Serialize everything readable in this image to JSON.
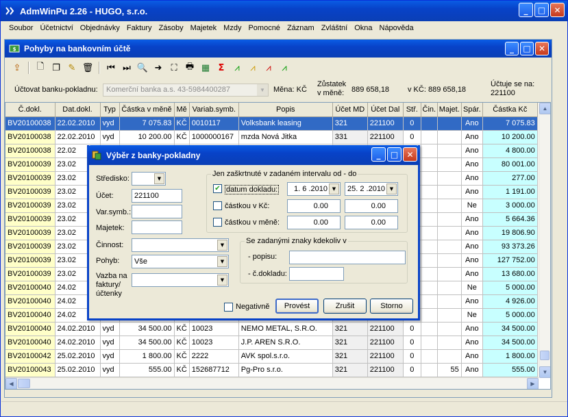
{
  "app": {
    "title": "AdmWinPu 2.26 - HUGO, s.r.o."
  },
  "menu": [
    "Soubor",
    "Účetnictví",
    "Objednávky",
    "Faktury",
    "Zásoby",
    "Majetek",
    "Mzdy",
    "Pomocné",
    "Záznam",
    "Zvláštní",
    "Okna",
    "Nápověda"
  ],
  "window": {
    "title": "Pohyby na bankovním účtě"
  },
  "account": {
    "label": "Účtovat banku-pokladnu:",
    "value": "Komerční banka a.s. 43-5984400287",
    "currency_label": "Měna: KČ",
    "balance_label": "Zůstatek",
    "balance_label2": "v měně:",
    "balance": "889 658,18",
    "balance_kc_label": "v KČ:",
    "balance_kc": "889 658,18",
    "account_label": "Účtuje se na:",
    "account": "221100"
  },
  "grid": {
    "columns": [
      "Č.dokl.",
      "Dat.dokl.",
      "Typ",
      "Částka v měně",
      "Mě",
      "Variab.symb.",
      "Popis",
      "Účet MD",
      "Účet Dal",
      "Stř.",
      "Čin.",
      "Majet.",
      "Spár.",
      "Částka Kč"
    ],
    "rows": [
      {
        "doc": "BV20100038",
        "date": "22.02.2010",
        "typ": "vyd",
        "amount": "7 075.83",
        "cur": "KČ",
        "vs": "0010117",
        "desc": "Volksbank leasing",
        "md": "321",
        "dal": "221100",
        "str": "0",
        "cin": "",
        "maj": "",
        "spar": "Ano",
        "kc": "7 075.83",
        "selected": true
      },
      {
        "doc": "BV20100038",
        "date": "22.02.2010",
        "typ": "vyd",
        "amount": "10 200.00",
        "cur": "KČ",
        "vs": "1000000167",
        "desc": "mzda Nová Jitka",
        "md": "331",
        "dal": "221100",
        "str": "0",
        "cin": "",
        "maj": "",
        "spar": "Ano",
        "kc": "10 200.00"
      },
      {
        "doc": "BV20100038",
        "date": "22.02",
        "typ": "",
        "amount": "",
        "cur": "",
        "vs": "",
        "desc": "",
        "md": "",
        "dal": "",
        "str": "",
        "cin": "",
        "maj": "",
        "spar": "Ano",
        "kc": "4 800.00"
      },
      {
        "doc": "BV20100039",
        "date": "23.02",
        "typ": "",
        "amount": "",
        "cur": "",
        "vs": "",
        "desc": "",
        "md": "",
        "dal": "",
        "str": "",
        "cin": "",
        "maj": "",
        "spar": "Ano",
        "kc": "80 001.00"
      },
      {
        "doc": "BV20100039",
        "date": "23.02",
        "typ": "",
        "amount": "",
        "cur": "",
        "vs": "",
        "desc": "",
        "md": "",
        "dal": "",
        "str": "",
        "cin": "",
        "maj": "",
        "spar": "Ano",
        "kc": "277.00"
      },
      {
        "doc": "BV20100039",
        "date": "23.02",
        "typ": "",
        "amount": "",
        "cur": "",
        "vs": "",
        "desc": "",
        "md": "",
        "dal": "",
        "str": "",
        "cin": "",
        "maj": "",
        "spar": "Ano",
        "kc": "1 191.00"
      },
      {
        "doc": "BV20100039",
        "date": "23.02",
        "typ": "",
        "amount": "",
        "cur": "",
        "vs": "",
        "desc": "",
        "md": "",
        "dal": "",
        "str": "",
        "cin": "",
        "maj": "",
        "spar": "Ne",
        "kc": "3 000.00"
      },
      {
        "doc": "BV20100039",
        "date": "23.02",
        "typ": "",
        "amount": "",
        "cur": "",
        "vs": "",
        "desc": "",
        "md": "",
        "dal": "",
        "str": "",
        "cin": "",
        "maj": "",
        "spar": "Ano",
        "kc": "5 664.36"
      },
      {
        "doc": "BV20100039",
        "date": "23.02",
        "typ": "",
        "amount": "",
        "cur": "",
        "vs": "",
        "desc": "",
        "md": "",
        "dal": "",
        "str": "",
        "cin": "",
        "maj": "",
        "spar": "Ano",
        "kc": "19 806.90"
      },
      {
        "doc": "BV20100039",
        "date": "23.02",
        "typ": "",
        "amount": "",
        "cur": "",
        "vs": "",
        "desc": "",
        "md": "",
        "dal": "",
        "str": "",
        "cin": "",
        "maj": "",
        "spar": "Ano",
        "kc": "93 373.26"
      },
      {
        "doc": "BV20100039",
        "date": "23.02",
        "typ": "",
        "amount": "",
        "cur": "",
        "vs": "",
        "desc": "",
        "md": "",
        "dal": "",
        "str": "",
        "cin": "",
        "maj": "",
        "spar": "Ano",
        "kc": "127 752.00"
      },
      {
        "doc": "BV20100039",
        "date": "23.02",
        "typ": "",
        "amount": "",
        "cur": "",
        "vs": "",
        "desc": "",
        "md": "",
        "dal": "",
        "str": "",
        "cin": "",
        "maj": "",
        "spar": "Ano",
        "kc": "13 680.00"
      },
      {
        "doc": "BV20100040",
        "date": "24.02",
        "typ": "",
        "amount": "",
        "cur": "",
        "vs": "",
        "desc": "",
        "md": "",
        "dal": "",
        "str": "",
        "cin": "",
        "maj": "",
        "spar": "Ne",
        "kc": "5 000.00"
      },
      {
        "doc": "BV20100040",
        "date": "24.02",
        "typ": "",
        "amount": "",
        "cur": "",
        "vs": "",
        "desc": "",
        "md": "",
        "dal": "",
        "str": "",
        "cin": "",
        "maj": "",
        "spar": "Ano",
        "kc": "4 926.00"
      },
      {
        "doc": "BV20100040",
        "date": "24.02",
        "typ": "",
        "amount": "",
        "cur": "",
        "vs": "",
        "desc": "",
        "md": "",
        "dal": "",
        "str": "",
        "cin": "",
        "maj": "",
        "spar": "Ne",
        "kc": "5 000.00"
      },
      {
        "doc": "BV20100040",
        "date": "24.02.2010",
        "typ": "vyd",
        "amount": "34 500.00",
        "cur": "KČ",
        "vs": "10023",
        "desc": "NEMO METAL, S.R.O.",
        "md": "321",
        "dal": "221100",
        "str": "0",
        "cin": "",
        "maj": "",
        "spar": "Ano",
        "kc": "34 500.00"
      },
      {
        "doc": "BV20100040",
        "date": "24.02.2010",
        "typ": "vyd",
        "amount": "34 500.00",
        "cur": "KČ",
        "vs": "10023",
        "desc": "J.P. AREN S.R.O.",
        "md": "321",
        "dal": "221100",
        "str": "0",
        "cin": "",
        "maj": "",
        "spar": "Ano",
        "kc": "34 500.00"
      },
      {
        "doc": "BV20100042",
        "date": "25.02.2010",
        "typ": "vyd",
        "amount": "1 800.00",
        "cur": "KČ",
        "vs": "2222",
        "desc": "AVK spol.s.r.o.",
        "md": "321",
        "dal": "221100",
        "str": "0",
        "cin": "",
        "maj": "",
        "spar": "Ano",
        "kc": "1 800.00"
      },
      {
        "doc": "BV20100043",
        "date": "25.02.2010",
        "typ": "vyd",
        "amount": "555.00",
        "cur": "KČ",
        "vs": "152687712",
        "desc": "Pg-Pro s.r.o.",
        "md": "321",
        "dal": "221100",
        "str": "0",
        "cin": "",
        "maj": "55",
        "spar": "Ano",
        "kc": "555.00"
      }
    ]
  },
  "dialog": {
    "title": "Výběr z banky-pokladny",
    "stredisko_label": "Středisko:",
    "ucet_label": "Účet:",
    "ucet_value": "221100",
    "varsymb_label": "Var.symb.:",
    "majetek_label": "Majetek:",
    "cinnost_label": "Činnost:",
    "pohyb_label": "Pohyb:",
    "pohyb_value": "Vše",
    "vazba_label1": "Vazba na",
    "vazba_label2": "faktury/",
    "vazba_label3": "účtenky",
    "group1_label": "Jen zaškrtnuté v zadaném intervalu od - do",
    "datum_label": "datum dokladu:",
    "datum_from": "1. 6 .2010",
    "datum_to": "25. 2 .2010",
    "castka_kc_label": "částkou v Kč:",
    "castka_kc_from": "0.00",
    "castka_kc_to": "0.00",
    "castka_mena_label": "částkou v měně:",
    "castka_mena_from": "0.00",
    "castka_mena_to": "0.00",
    "group2_label": "Se zadanými znaky kdekoliv v",
    "popisu_label": "- popisu:",
    "cdokladu_label": "- č.dokladu:",
    "negativne_label": "Negativně",
    "provest_label": "Provést",
    "zrusit_label": "Zrušit",
    "storno_label": "Storno"
  }
}
